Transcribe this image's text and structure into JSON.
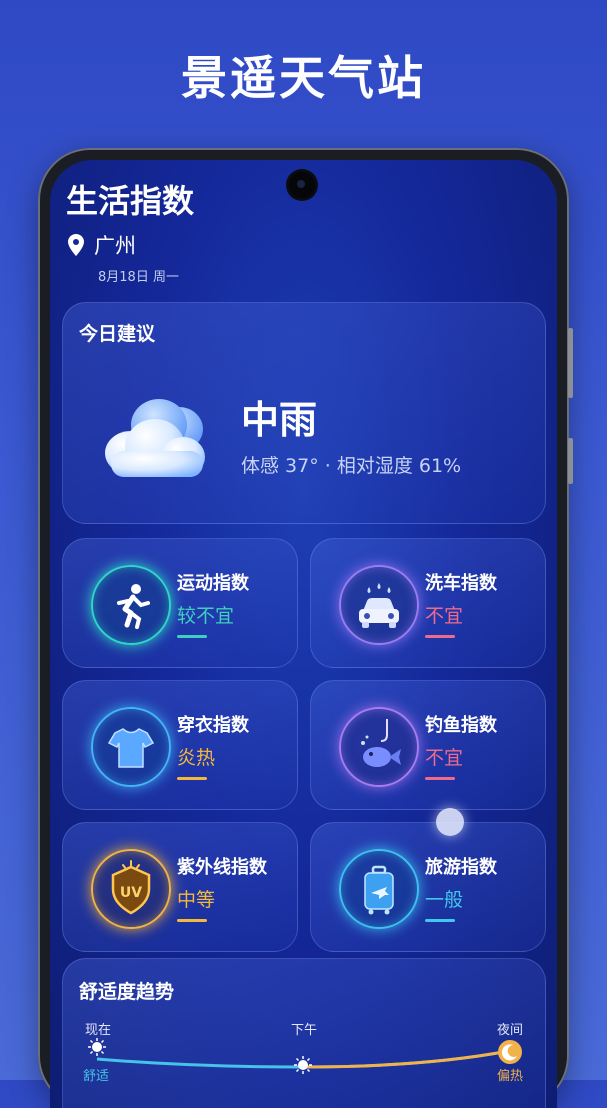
{
  "promo": {
    "title": "景遥天气站"
  },
  "header": {
    "title": "生活指数",
    "city": "广州",
    "date": "8月18日 周一"
  },
  "today": {
    "label": "今日建议",
    "weather": "中雨",
    "detail": "体感 37° · 相对湿度 61%",
    "icon": "cloud-icon"
  },
  "indices": [
    {
      "name": "运动指数",
      "value": "较不宜",
      "icon": "running-icon",
      "color": "#3fd0bd"
    },
    {
      "name": "洗车指数",
      "value": "不宜",
      "icon": "car-wash-icon",
      "color": "#f06b8a"
    },
    {
      "name": "穿衣指数",
      "value": "炎热",
      "icon": "tshirt-icon",
      "color": "#f4b93a"
    },
    {
      "name": "钓鱼指数",
      "value": "不宜",
      "icon": "fish-icon",
      "color": "#f06b8a"
    },
    {
      "name": "紫外线指数",
      "value": "中等",
      "icon": "uv-shield-icon",
      "color": "#f4b93a"
    },
    {
      "name": "旅游指数",
      "value": "一般",
      "icon": "luggage-icon",
      "color": "#43c7ee"
    }
  ],
  "comfort": {
    "label": "舒适度趋势",
    "points": [
      {
        "time": "现在",
        "status": "舒适",
        "icon": "sun-icon"
      },
      {
        "time": "下午",
        "status": "",
        "icon": "sun-icon"
      },
      {
        "time": "夜间",
        "status": "偏热",
        "icon": "moon-icon"
      }
    ]
  }
}
